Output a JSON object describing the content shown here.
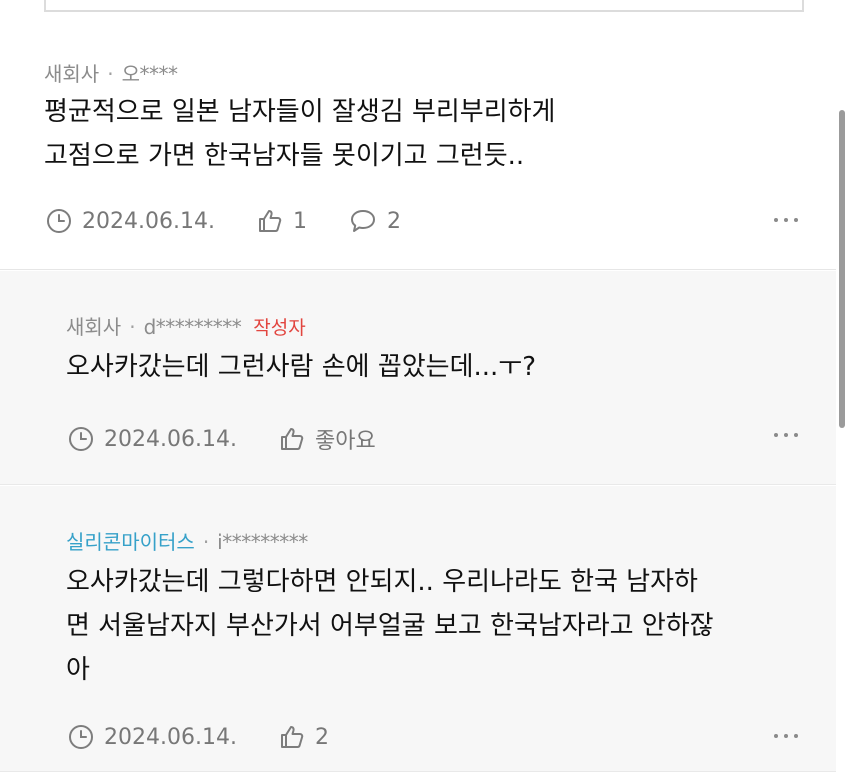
{
  "comments": [
    {
      "nickname": "새회사",
      "separator": "·",
      "masked_id": "오****",
      "author_badge": "",
      "body_lines": [
        "평균적으로 일본 남자들이 잘생김 부리부리하게",
        "고점으로 가면 한국남자들 못이기고 그런듯.."
      ],
      "date": "2024.06.14.",
      "likes": "1",
      "replies": "2"
    },
    {
      "nickname": "새회사",
      "separator": "·",
      "masked_id": "d*********",
      "author_badge": "작성자",
      "body_lines": [
        "오사카갔는데 그런사람 손에 꼽았는데...ㅜ?"
      ],
      "date": "2024.06.14.",
      "likes": "좋아요"
    },
    {
      "nickname": "실리콘마이터스",
      "separator": "·",
      "masked_id": "i*********",
      "author_badge": "",
      "body_lines": [
        "오사카갔는데 그렇다하면 안되지.. 우리나라도 한국 남자하",
        "면 서울남자지 부산가서 어부얼굴 보고 한국남자라고 안하잖",
        "아"
      ],
      "date": "2024.06.14.",
      "likes": "2"
    }
  ],
  "colors": {
    "accent_nickname": "#36a1c9",
    "author_badge": "#e2453f",
    "meta_gray": "#8c8c8c",
    "reply_background": "#f7f7f7"
  },
  "icons": [
    "clock-icon",
    "thumbs-up-icon",
    "speech-bubble-icon",
    "more-dots-icon"
  ]
}
